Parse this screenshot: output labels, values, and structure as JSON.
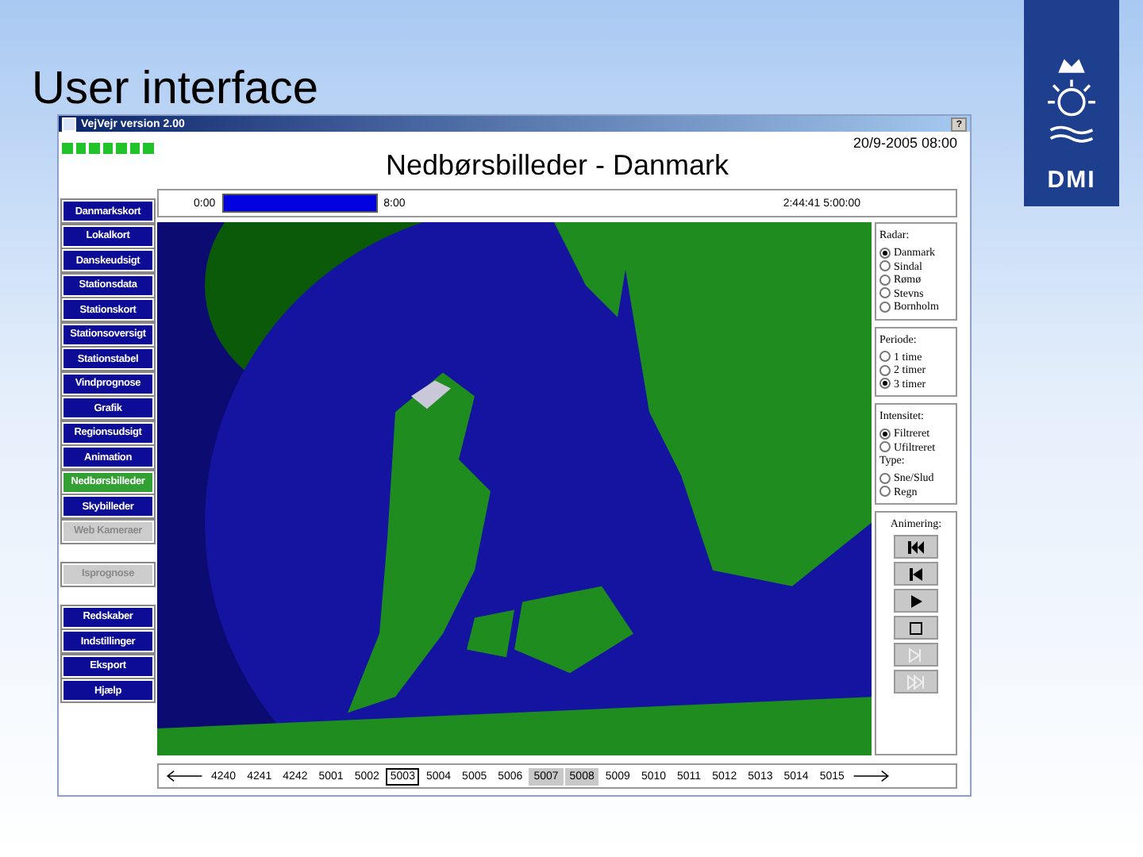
{
  "slide": {
    "title": "User interface",
    "logo_text": "DMI"
  },
  "window": {
    "title": "VejVejr version 2.00",
    "help": "?"
  },
  "status_lights": [
    {
      "on": true
    },
    {
      "on": true
    },
    {
      "on": true
    },
    {
      "on": true
    },
    {
      "on": true
    },
    {
      "on": true
    },
    {
      "on": true
    }
  ],
  "header": {
    "title": "Nedbørsbilleder - Danmark",
    "datetime": "20/9-2005 08:00"
  },
  "timebar": {
    "start": "0:00",
    "end": "8:00",
    "level": 1.0,
    "readout": "2:44:41 5:00:00"
  },
  "sidebar": {
    "groups": [
      [
        {
          "label": "Danmarkskort",
          "selected": false,
          "disabled": false
        },
        {
          "label": "Lokalkort",
          "selected": false,
          "disabled": false
        },
        {
          "label": "Danskeudsigt",
          "selected": false,
          "disabled": false
        },
        {
          "label": "Stationsdata",
          "selected": false,
          "disabled": false
        },
        {
          "label": "Stationskort",
          "selected": false,
          "disabled": false
        },
        {
          "label": "Stationsoversigt",
          "selected": false,
          "disabled": false
        },
        {
          "label": "Stationstabel",
          "selected": false,
          "disabled": false
        },
        {
          "label": "Vindprognose",
          "selected": false,
          "disabled": false
        },
        {
          "label": "Grafik",
          "selected": false,
          "disabled": false
        },
        {
          "label": "Regionsudsigt",
          "selected": false,
          "disabled": false
        },
        {
          "label": "Animation",
          "selected": false,
          "disabled": false
        },
        {
          "label": "Nedbørsbilleder",
          "selected": true,
          "disabled": false
        },
        {
          "label": "Skybilleder",
          "selected": false,
          "disabled": false
        },
        {
          "label": "Web Kameraer",
          "selected": false,
          "disabled": true
        }
      ],
      [
        {
          "label": "Isprognose",
          "selected": false,
          "disabled": true
        }
      ],
      [
        {
          "label": "Redskaber",
          "selected": false,
          "disabled": false
        },
        {
          "label": "Indstillinger",
          "selected": false,
          "disabled": false
        },
        {
          "label": "Eksport",
          "selected": false,
          "disabled": false
        },
        {
          "label": "Hjælp",
          "selected": false,
          "disabled": false
        }
      ]
    ]
  },
  "panel": {
    "sections": [
      {
        "kind": "radio",
        "groups": [
          {
            "title": "Radar:",
            "options": [
              {
                "label": "Danmark",
                "selected": true
              },
              {
                "label": "Sindal",
                "selected": false
              },
              {
                "label": "Rømø",
                "selected": false
              },
              {
                "label": "Stevns",
                "selected": false
              },
              {
                "label": "Bornholm",
                "selected": false
              }
            ]
          }
        ]
      },
      {
        "kind": "radio",
        "groups": [
          {
            "title": "Periode:",
            "options": [
              {
                "label": "1 time",
                "selected": false
              },
              {
                "label": "2 timer",
                "selected": false
              },
              {
                "label": "3 timer",
                "selected": true
              }
            ]
          }
        ]
      },
      {
        "kind": "radio",
        "groups": [
          {
            "title": "Intensitet:",
            "options": [
              {
                "label": "Filtreret",
                "selected": true
              },
              {
                "label": "Ufiltreret",
                "selected": false
              }
            ]
          },
          {
            "title": "Type:",
            "options": [
              {
                "label": "Sne/Slud",
                "selected": false
              },
              {
                "label": "Regn",
                "selected": false
              }
            ]
          }
        ]
      },
      {
        "kind": "player",
        "title": "Animering:",
        "buttons": [
          {
            "kind": "first",
            "disabled": false
          },
          {
            "kind": "prev",
            "disabled": false
          },
          {
            "kind": "play",
            "disabled": false
          },
          {
            "kind": "stop",
            "disabled": false
          },
          {
            "kind": "next",
            "disabled": true
          },
          {
            "kind": "last",
            "disabled": true
          }
        ]
      }
    ]
  },
  "timeline": {
    "frames": [
      {
        "label": "4240",
        "selected": false,
        "highlighted": false
      },
      {
        "label": "4241",
        "selected": false,
        "highlighted": false
      },
      {
        "label": "4242",
        "selected": false,
        "highlighted": false
      },
      {
        "label": "5001",
        "selected": false,
        "highlighted": false
      },
      {
        "label": "5002",
        "selected": false,
        "highlighted": false
      },
      {
        "label": "5003",
        "selected": true,
        "highlighted": false
      },
      {
        "label": "5004",
        "selected": false,
        "highlighted": false
      },
      {
        "label": "5005",
        "selected": false,
        "highlighted": false
      },
      {
        "label": "5006",
        "selected": false,
        "highlighted": false
      },
      {
        "label": "5007",
        "selected": false,
        "highlighted": true
      },
      {
        "label": "5008",
        "selected": false,
        "highlighted": true
      },
      {
        "label": "5009",
        "selected": false,
        "highlighted": false
      },
      {
        "label": "5010",
        "selected": false,
        "highlighted": false
      },
      {
        "label": "5011",
        "selected": false,
        "highlighted": false
      },
      {
        "label": "5012",
        "selected": false,
        "highlighted": false
      },
      {
        "label": "5013",
        "selected": false,
        "highlighted": false
      },
      {
        "label": "5014",
        "selected": false,
        "highlighted": false
      },
      {
        "label": "5015",
        "selected": false,
        "highlighted": false
      }
    ]
  }
}
